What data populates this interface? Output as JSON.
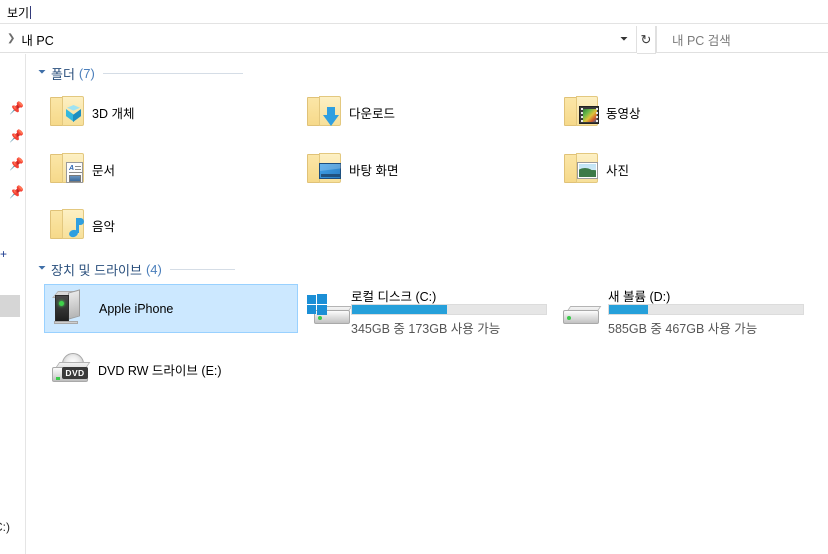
{
  "window": {
    "ribbon_tab": "보기"
  },
  "address_bar": {
    "breadcrumb": "내 PC",
    "chevron_icon": "chevron-right-icon",
    "dropdown_icon": "chevron-down-icon",
    "refresh_icon": "refresh-icon"
  },
  "search": {
    "placeholder": "내 PC 검색",
    "value": ""
  },
  "nav_pane": {
    "pins": [
      "pin-icon",
      "pin-icon",
      "pin-icon",
      "pin-icon"
    ],
    "expand_icon": "+",
    "bottom_label": "C:)"
  },
  "groups": [
    {
      "title": "폴더",
      "count": "(7)",
      "chevron_icon": "chevron-down-icon"
    },
    {
      "title": "장치 및 드라이브",
      "count": "(4)",
      "chevron_icon": "chevron-down-icon"
    }
  ],
  "folders": [
    {
      "label": "3D 개체",
      "icon": "folder-3d-objects-icon"
    },
    {
      "label": "다운로드",
      "icon": "folder-downloads-icon"
    },
    {
      "label": "동영상",
      "icon": "folder-videos-icon"
    },
    {
      "label": "문서",
      "icon": "folder-documents-icon"
    },
    {
      "label": "바탕 화면",
      "icon": "folder-desktop-icon"
    },
    {
      "label": "사진",
      "icon": "folder-pictures-icon"
    },
    {
      "label": "음악",
      "icon": "folder-music-icon"
    }
  ],
  "devices": [
    {
      "label": "Apple iPhone",
      "icon": "portable-device-icon",
      "selected": true
    },
    {
      "label": "로컬 디스크 (C:)",
      "icon": "hard-drive-windows-icon",
      "free_text": "345GB 중 173GB 사용 가능",
      "used_percent": 49
    },
    {
      "label": "새 볼륨 (D:)",
      "icon": "hard-drive-icon",
      "free_text": "585GB 중 467GB 사용 가능",
      "used_percent": 20
    },
    {
      "label": "DVD RW 드라이브 (E:)",
      "icon": "dvd-drive-icon",
      "badge": "DVD"
    }
  ],
  "colors": {
    "selection_fill": "#cce8ff",
    "selection_border": "#99d1ff",
    "progress_fill": "#26a0da",
    "progress_track": "#e6e6e6",
    "group_title": "#2a4f7c"
  }
}
